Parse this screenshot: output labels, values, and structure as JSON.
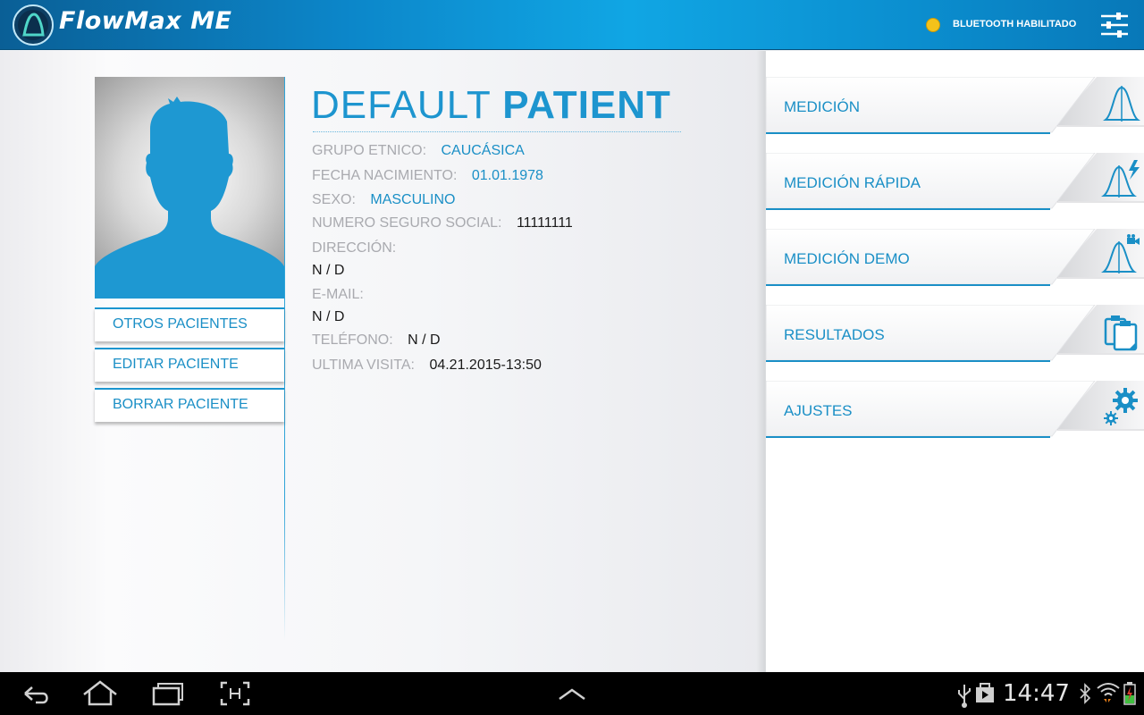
{
  "header": {
    "app_title": "FlowMax ME",
    "bluetooth_status": "BLUETOOTH HABILITADO",
    "bluetooth_dot_color": "#f4c21a",
    "logo_icon": "flowmax-logo-icon",
    "settings_icon": "sliders-icon"
  },
  "patient": {
    "name_light": "DEFAULT",
    "name_bold": "PATIENT",
    "fields": [
      {
        "label": "GRUPO ETNICO:",
        "value": "CAUCÁSICA"
      },
      {
        "label": "FECHA NACIMIENTO:",
        "value": "01.01.1978"
      },
      {
        "label": "SEXO:",
        "value": "MASCULINO"
      },
      {
        "label": "NUMERO SEGURO SOCIAL:",
        "value": "11111111"
      },
      {
        "label": "DIRECCIÓN:",
        "value": "N / D"
      },
      {
        "label": "E-MAIL:",
        "value": "N / D"
      },
      {
        "label": "TELÉFONO:",
        "value": "N / D"
      },
      {
        "label": "ULTIMA VISITA:",
        "value": "04.21.2015-13:50"
      }
    ]
  },
  "side_buttons": {
    "others": "OTROS PACIENTES",
    "edit": "EDITAR PACIENTE",
    "delete": "BORRAR PACIENTE"
  },
  "menu": [
    {
      "label": "MEDICIÓN",
      "icon": "bell-curve-icon"
    },
    {
      "label": "MEDICIÓN RÁPIDA",
      "icon": "bell-curve-lightning-icon"
    },
    {
      "label": "MEDICIÓN DEMO",
      "icon": "bell-curve-camera-icon"
    },
    {
      "label": "RESULTADOS",
      "icon": "clipboard-copy-icon"
    },
    {
      "label": "AJUSTES",
      "icon": "gears-icon"
    }
  ],
  "system_bar": {
    "time": "14:47",
    "icons": [
      "back-icon",
      "home-icon",
      "recent-apps-icon",
      "screenshot-icon",
      "chevron-up-icon",
      "usb-icon",
      "shop-bag-icon",
      "bluetooth-icon",
      "wifi-icon",
      "battery-icon"
    ]
  },
  "colors": {
    "accent": "#1a8fc6",
    "header_blue": "#0c86c9",
    "label_gray": "#a9aaaf"
  }
}
